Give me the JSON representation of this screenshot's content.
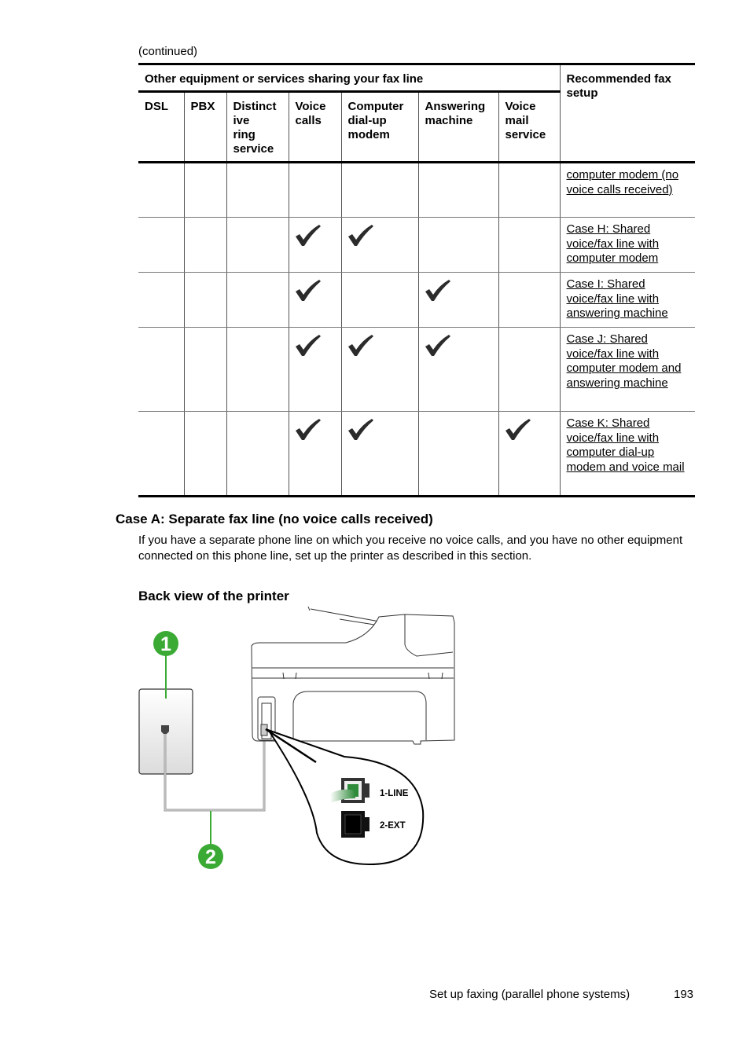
{
  "page": {
    "continued_label": "(continued)",
    "table": {
      "group_header": "Other equipment or services sharing your fax line",
      "recommended_header": "Recommended fax setup",
      "columns": [
        "DSL",
        "PBX",
        "Distinctive ring service",
        "Voice calls",
        "Computer dial-up modem",
        "Answering machine",
        "Voice mail service"
      ],
      "column_display": [
        [
          "DSL"
        ],
        [
          "PBX"
        ],
        [
          "Distinct",
          "ive",
          "ring",
          "service"
        ],
        [
          "Voice",
          "calls"
        ],
        [
          "Computer",
          "dial-up",
          "modem"
        ],
        [
          "Answering",
          "machine"
        ],
        [
          "Voice",
          "mail",
          "service"
        ]
      ],
      "rows": [
        {
          "checks": [
            false,
            false,
            false,
            false,
            false,
            false,
            false
          ],
          "setup": "computer modem (no voice calls received)"
        },
        {
          "checks": [
            false,
            false,
            false,
            true,
            true,
            false,
            false
          ],
          "setup": "Case H: Shared voice/fax line with computer modem"
        },
        {
          "checks": [
            false,
            false,
            false,
            true,
            false,
            true,
            false
          ],
          "setup": "Case I: Shared voice/fax line with answering machine"
        },
        {
          "checks": [
            false,
            false,
            false,
            true,
            true,
            true,
            false
          ],
          "setup": "Case J: Shared voice/fax line with computer modem and answering machine"
        },
        {
          "checks": [
            false,
            false,
            false,
            true,
            true,
            false,
            true
          ],
          "setup": "Case K: Shared voice/fax line with computer dial-up modem and voice mail"
        }
      ]
    },
    "section_heading": "Case A: Separate fax line (no voice calls received)",
    "section_paragraph": "If you have a separate phone line on which you receive no voice calls, and you have no other equipment connected on this phone line, set up the printer as described in this section.",
    "figure_heading": "Back view of the printer",
    "figure": {
      "callouts": [
        "1",
        "2"
      ],
      "port_labels": [
        "1-LINE",
        "2-EXT"
      ],
      "accent_color": "#3aaa35"
    },
    "footer": {
      "title": "Set up faxing (parallel phone systems)",
      "page_number": "193"
    }
  }
}
